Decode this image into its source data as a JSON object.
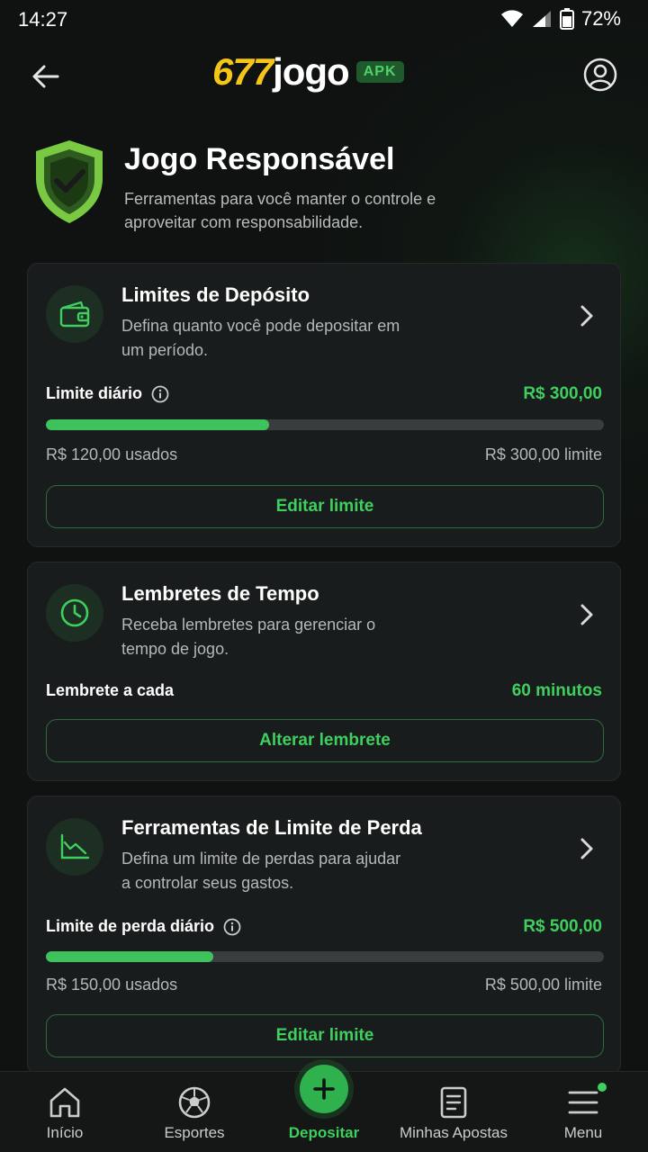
{
  "status_bar": {
    "time": "14:27",
    "battery": "72%"
  },
  "header": {
    "logo_number": "677",
    "logo_word": "jogo",
    "badge": "APK"
  },
  "hero": {
    "title": "Jogo Responsável",
    "description": "Ferramentas para você manter o controle e aproveitar com responsabilidade."
  },
  "cards": [
    {
      "title": "Limites de Depósito",
      "description": "Defina quanto você pode depositar em um período.",
      "row_label": "Limite diário",
      "row_value": "R$ 300,00",
      "progress_fraction": 0.4,
      "used_text": "R$ 120,00 usados",
      "limit_text": "R$ 300,00 limite",
      "button": "Editar limite",
      "icon": "wallet-icon"
    },
    {
      "title": "Lembretes de Tempo",
      "description": "Receba lembretes para gerenciar o tempo de jogo.",
      "row_label": "Lembrete a cada",
      "row_value": "60 minutos",
      "button": "Alterar lembrete",
      "icon": "clock-icon"
    },
    {
      "title": "Ferramentas de Limite de Perda",
      "description": "Defina um limite de perdas para ajudar a controlar seus gastos.",
      "row_label": "Limite de perda diário",
      "row_value": "R$ 500,00",
      "progress_fraction": 0.3,
      "used_text": "R$ 150,00 usados",
      "limit_text": "R$ 500,00 limite",
      "button": "Editar limite",
      "icon": "chart-down-icon"
    }
  ],
  "bottom_nav": [
    {
      "label": "Início",
      "icon": "home-icon"
    },
    {
      "label": "Esportes",
      "icon": "soccer-ball-icon"
    },
    {
      "label": "Depositar",
      "icon": "plus-icon",
      "active": true
    },
    {
      "label": "Minhas Apostas",
      "icon": "document-icon"
    },
    {
      "label": "Menu",
      "icon": "menu-icon"
    }
  ],
  "colors": {
    "accent": "#3fcf5e",
    "logo_yellow": "#f5c518",
    "background": "#0f1211",
    "card": "#191c1c"
  }
}
